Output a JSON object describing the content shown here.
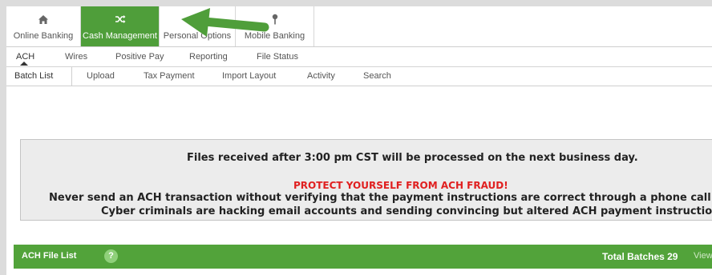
{
  "modules": [
    {
      "label": "Online Banking",
      "icon": "home-icon",
      "active": false
    },
    {
      "label": "Cash Management",
      "icon": "shuffle-icon",
      "active": true
    },
    {
      "label": "Personal Options",
      "icon": "",
      "active": false
    },
    {
      "label": "Mobile Banking",
      "icon": "mobile-pin-icon",
      "active": false
    }
  ],
  "subnav": [
    "ACH",
    "Wires",
    "Positive Pay",
    "Reporting",
    "File Status"
  ],
  "subsubnav": [
    "Batch List",
    "Upload",
    "Tax Payment",
    "Import Layout",
    "Activity",
    "Search"
  ],
  "notice": {
    "line1": "Files received after 3:00 pm CST will be processed on the next business day.",
    "warning": "PROTECT YOURSELF FROM ACH FRAUD!",
    "line3": "Never send an ACH transaction without verifying that the payment instructions are correct through a phone call or in",
    "line4": "Cyber criminals are hacking email accounts and sending convincing but altered ACH payment instructions."
  },
  "list": {
    "title": "ACH File List",
    "help": "?",
    "total": "Total Batches 29",
    "view": "View"
  },
  "colors": {
    "accent_green": "#4f9e3a",
    "warning_red": "#e02020",
    "annotation_arrow": "#4f9e3a"
  }
}
